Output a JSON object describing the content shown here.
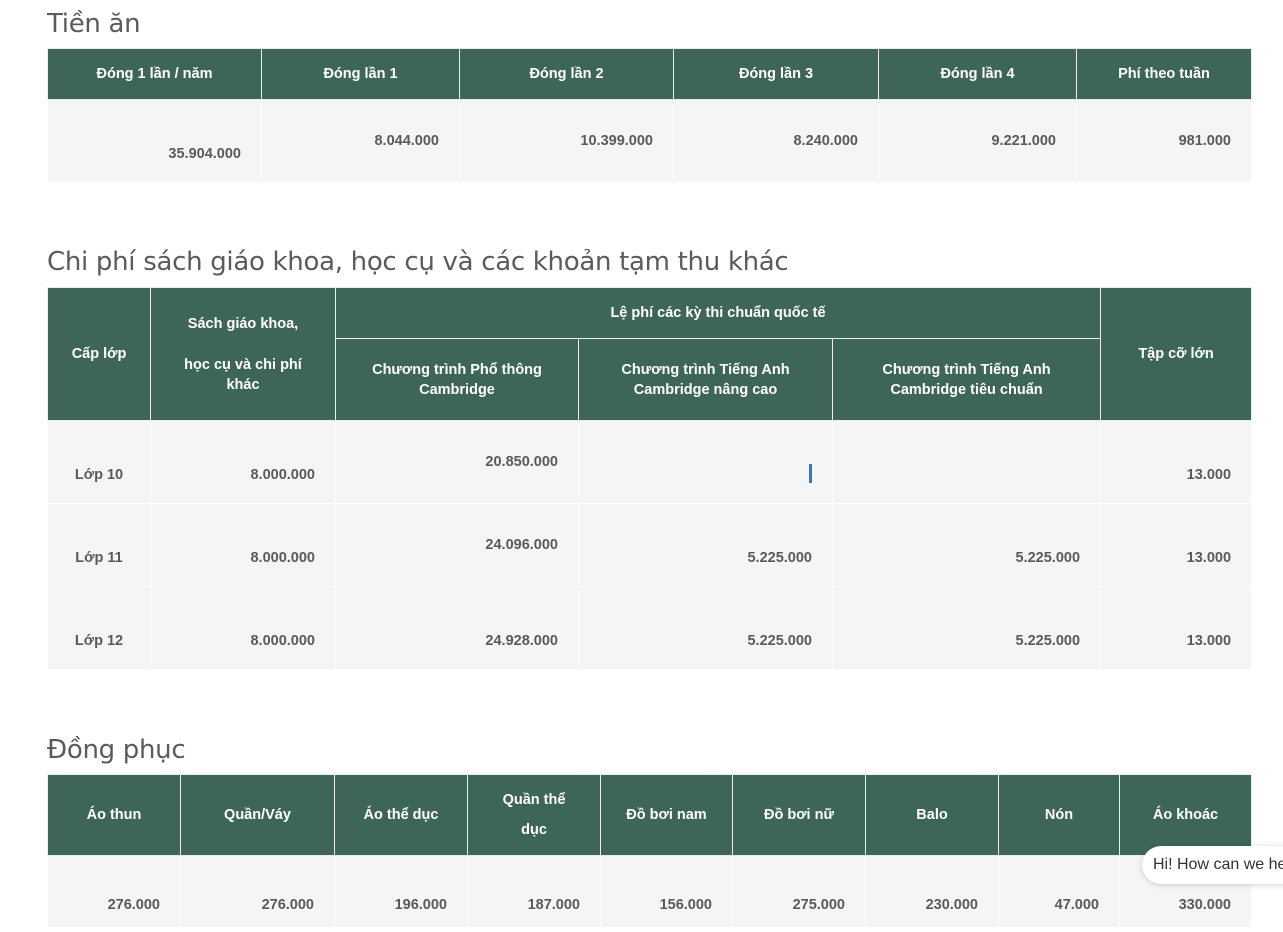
{
  "meals": {
    "title": "Tiền ăn",
    "headers": [
      "Đóng 1 lần / năm",
      "Đóng lần  1",
      "Đóng lần 2",
      "Đóng lần 3",
      "Đóng lần 4",
      "Phí theo tuần"
    ],
    "values": [
      "35.904.000",
      "8.044.000",
      "10.399.000",
      "8.240.000",
      "9.221.000",
      "981.000"
    ]
  },
  "books": {
    "title": "Chi phí sách giáo khoa, học cụ và các khoản tạm thu khác",
    "headers": {
      "grade": "Cấp lớp",
      "books_line1": "Sách giáo khoa,",
      "books_line2": "học cụ và chi phí khác",
      "exam_group": "Lệ phí các kỳ thi chuẩn quốc tế",
      "exam_general": "Chương trình Phổ thông Cambridge",
      "exam_advanced": "Chương trình Tiếng Anh Cambridge nâng cao",
      "exam_standard": "Chương trình Tiếng Anh Cambridge tiêu chuẩn",
      "notebook": "Tập cỡ lớn"
    },
    "rows": [
      {
        "grade": "Lớp 10",
        "books": "8.000.000",
        "exam_general": "20.850.000",
        "exam_advanced": "",
        "exam_standard": "",
        "notebook": "13.000"
      },
      {
        "grade": "Lớp 11",
        "books": "8.000.000",
        "exam_general": "24.096.000",
        "exam_advanced": "5.225.000",
        "exam_standard": "5.225.000",
        "notebook": "13.000"
      },
      {
        "grade": "Lớp 12",
        "books": "8.000.000",
        "exam_general": "24.928.000",
        "exam_advanced": "5.225.000",
        "exam_standard": "5.225.000",
        "notebook": "13.000"
      }
    ]
  },
  "uniform": {
    "title": "Đồng phục",
    "headers": [
      "Áo thun",
      "Quần/Váy",
      "Áo thể dục",
      "Quần thể",
      "dục",
      "Đồ bơi nam",
      "Đồ bơi nữ",
      "Balo",
      "Nón",
      "Áo khoác"
    ],
    "values": [
      "276.000",
      "276.000",
      "196.000",
      "187.000",
      "156.000",
      "275.000",
      "230.000",
      "47.000",
      "330.000"
    ]
  },
  "chat": {
    "message": "Hi! How can we help?"
  },
  "colors": {
    "header_bg": "#3e6658",
    "cell_bg": "#f4f5f4",
    "title_text": "#5b5b5b",
    "cursor": "#1f7ce8"
  }
}
